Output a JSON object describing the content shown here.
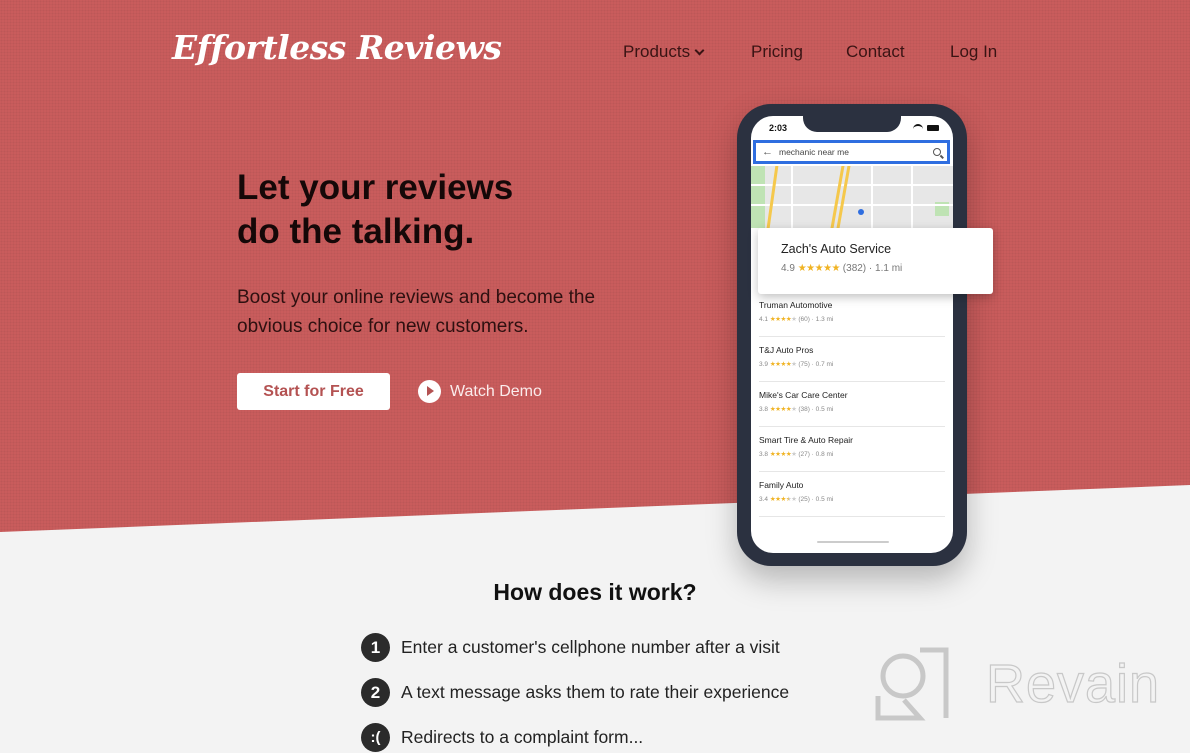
{
  "brand": {
    "logo_text": "Effortless Reviews",
    "accent_color": "#c95c5c"
  },
  "nav": {
    "items": [
      {
        "label": "Products",
        "has_dropdown": true
      },
      {
        "label": "Pricing"
      },
      {
        "label": "Contact"
      },
      {
        "label": "Log In"
      }
    ]
  },
  "hero": {
    "headline_line1": "Let your reviews",
    "headline_line2": "do the talking.",
    "subtext": "Boost your online reviews and become the obvious choice for new customers.",
    "cta_label": "Start for Free",
    "demo_label": "Watch Demo"
  },
  "phone": {
    "status_time": "2:03",
    "search_query": "mechanic near me",
    "featured": {
      "name": "Zach's Auto Service",
      "rating": "4.9",
      "stars": 5,
      "reviews": "(382)",
      "distance": "1.1 mi"
    },
    "results": [
      {
        "name": "Truman Automotive",
        "rating": "4.1",
        "stars": 4,
        "reviews": "(60)",
        "distance": "1.3 mi"
      },
      {
        "name": "T&J Auto Pros",
        "rating": "3.9",
        "stars": 4,
        "reviews": "(75)",
        "distance": "0.7 mi"
      },
      {
        "name": "Mike's Car Care Center",
        "rating": "3.8",
        "stars": 4,
        "reviews": "(38)",
        "distance": "0.5 mi"
      },
      {
        "name": "Smart Tire & Auto Repair",
        "rating": "3.8",
        "stars": 4,
        "reviews": "(27)",
        "distance": "0.8 mi"
      },
      {
        "name": "Family Auto",
        "rating": "3.4",
        "stars": 3.5,
        "reviews": "(25)",
        "distance": "0.5 mi"
      }
    ]
  },
  "how": {
    "title": "How does it work?",
    "steps": [
      {
        "badge": "1",
        "text": "Enter a customer's cellphone number after a visit"
      },
      {
        "badge": "2",
        "text": "A text message asks them to rate their experience"
      },
      {
        "badge": ":(",
        "text": "Redirects to a complaint form..."
      }
    ]
  },
  "watermark": {
    "text": "Revain"
  }
}
